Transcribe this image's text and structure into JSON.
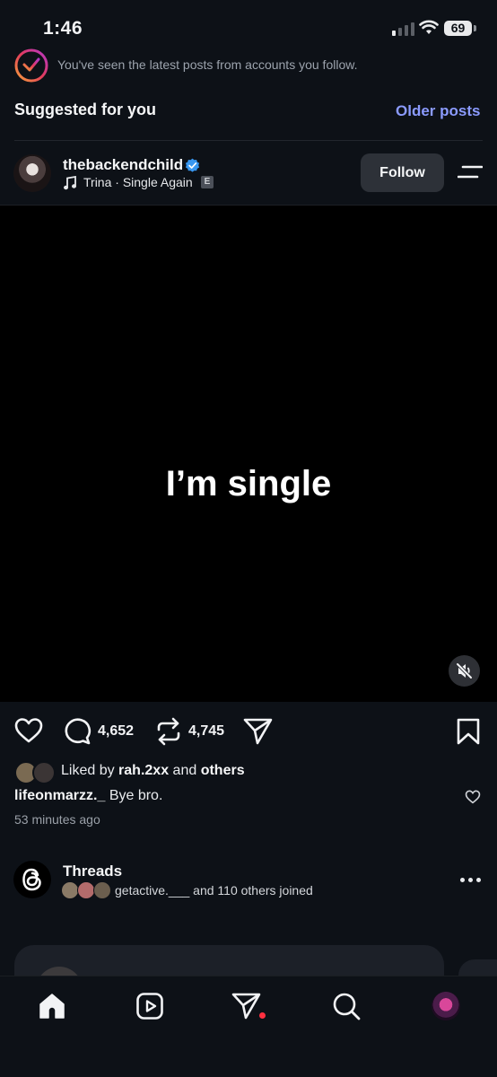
{
  "status_bar": {
    "time": "1:46",
    "battery": "69"
  },
  "feed": {
    "seen_message": "You've seen the latest posts from accounts you follow.",
    "suggested_title": "Suggested for you",
    "older_posts_label": "Older posts"
  },
  "post": {
    "username": "thebackendchild",
    "song": "Trina · Single Again",
    "explicit_badge": "E",
    "follow_label": "Follow",
    "media_text": "I’m single",
    "comments_count": "4,652",
    "reposts_count": "4,745",
    "liked_by_prefix": "Liked by",
    "liked_by_user": "rah.2xx",
    "liked_by_and": "and",
    "liked_by_others": "others",
    "comment_user": "lifeonmarzz._",
    "comment_text": "Bye bro.",
    "time_ago": "53 minutes ago"
  },
  "threads": {
    "title": "Threads",
    "joined_text": "getactive.___ and 110 others joined"
  },
  "colors": {
    "background": "#0d1117",
    "accent": "#8b9bff",
    "verified": "#3897f0",
    "notification": "#ff3040"
  },
  "icons": {
    "tabs": [
      "home-icon",
      "reels-icon",
      "direct-messages-icon",
      "search-icon",
      "profile-avatar"
    ]
  }
}
